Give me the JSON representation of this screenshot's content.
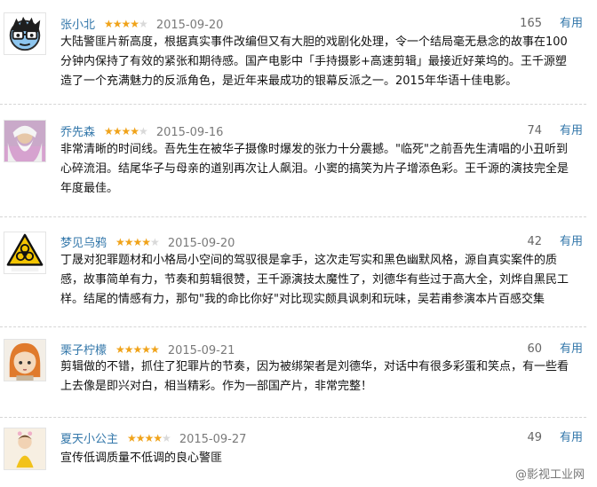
{
  "reviews": [
    {
      "user": "张小北",
      "rating": 4,
      "date": "2015-09-20",
      "votes": "165",
      "useful_label": "有用",
      "avatar_icon": "cartoon-glasses-face-icon",
      "text": "大陆警匪片新高度，根据真实事件改编但又有大胆的戏剧化处理，令一个结局毫无悬念的故事在100分钟内保持了有效的紧张和期待感。国产电影中「手持摄影+高速剪辑」最接近好莱坞的。王千源塑造了一个充满魅力的反派角色，是近年来最成功的银幕反派之一。2015年华语十佳电影。"
    },
    {
      "user": "乔先森",
      "rating": 4,
      "date": "2015-09-16",
      "votes": "74",
      "useful_label": "有用",
      "avatar_icon": "white-beard-wizard-icon",
      "text": "非常清晰的时间线。吾先生在被华子摄像时爆发的张力十分震撼。\"临死\"之前吾先生清唱的小丑听到心碎流泪。结尾华子与母亲的道别再次让人飙泪。小窦的搞笑为片子增添色彩。王千源的演技完全是年度最佳。"
    },
    {
      "user": "梦见乌鸦",
      "rating": 4,
      "date": "2015-09-20",
      "votes": "42",
      "useful_label": "有用",
      "avatar_icon": "biohazard-sign-icon",
      "avatar_caption": "当心感染",
      "text": "丁晟对犯罪题材和小格局小空间的驾驭很是拿手，这次走写实和黑色幽默风格，源自真实案件的质感，故事简单有力，节奏和剪辑很赞，王千源演技太魔性了，刘德华有些过于高大全，刘烨自黑民工样。结尾的情感有力，那句\"我的命比你好\"对比现实颇具讽刺和玩味，吴若甫参演本片百感交集"
    },
    {
      "user": "栗子柠檬",
      "rating": 5,
      "date": "2015-09-21",
      "votes": "60",
      "useful_label": "有用",
      "avatar_icon": "orange-hair-girl-icon",
      "text": "剪辑做的不错，抓住了犯罪片的节奏，因为被绑架者是刘德华，对话中有很多彩蛋和笑点，有一些看上去像是即兴对白，相当精彩。作为一部国产片，非常完整！"
    },
    {
      "user": "夏天小公主",
      "rating": 4,
      "date": "2015-09-27",
      "votes": "49",
      "useful_label": "有用",
      "avatar_icon": "yellow-dress-girl-icon",
      "text": "宣传低调质量不低调的良心警匪"
    }
  ],
  "watermark": "@影视工业网",
  "colors": {
    "link": "#3377aa",
    "star": "#f0a31a",
    "star_empty": "#d9d9d9",
    "date": "#7a7a7a",
    "separator": "#d6d6d6"
  }
}
